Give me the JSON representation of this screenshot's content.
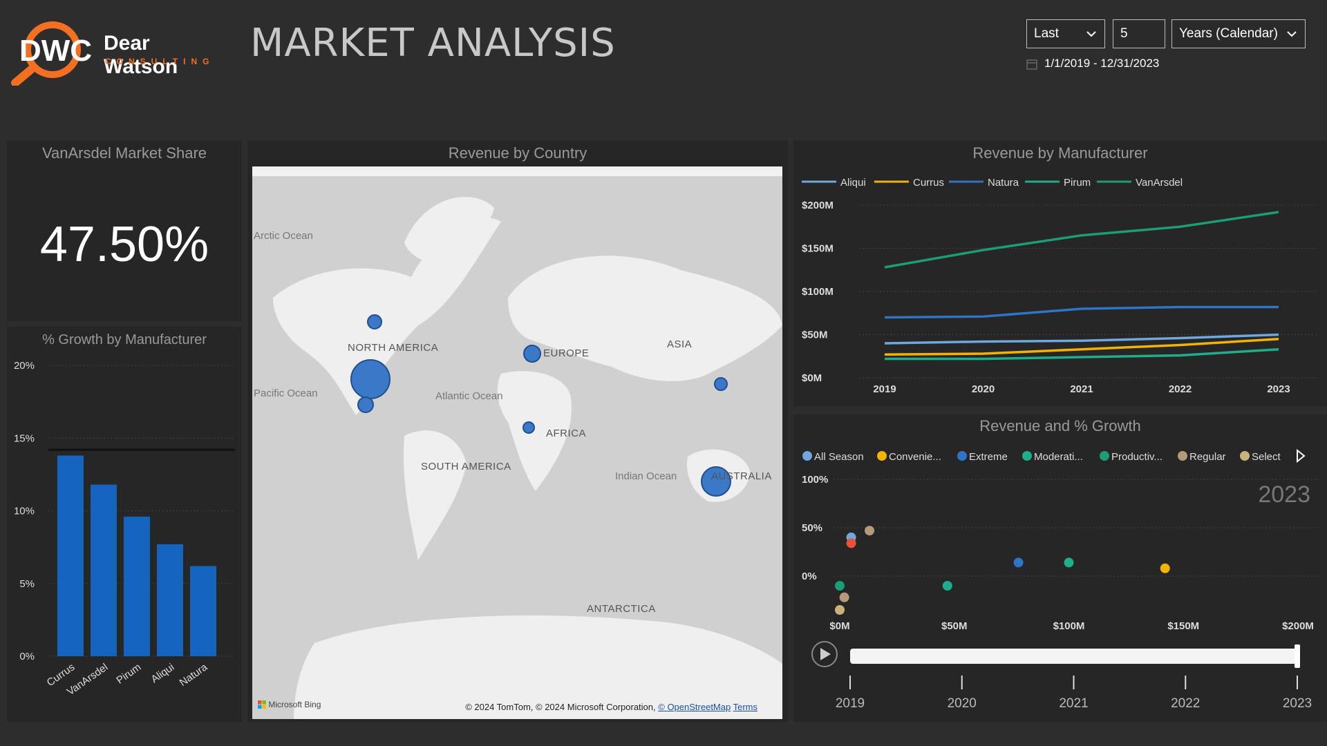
{
  "header": {
    "logo_mark": "DWC",
    "logo_name": "Dear Watson",
    "logo_sub": "CONSULTING",
    "title": "MARKET ANALYSIS"
  },
  "filters": {
    "period": "Last",
    "count": "5",
    "unit": "Years (Calendar)",
    "date_range": "1/1/2019 - 12/31/2023"
  },
  "market_share": {
    "title": "VanArsdel Market Share",
    "value": "47.50%"
  },
  "growth_panel": {
    "title": "% Growth by Manufacturer"
  },
  "map_panel": {
    "title": "Revenue by Country",
    "continents": [
      "NORTH AMERICA",
      "EUROPE",
      "ASIA",
      "AFRICA",
      "SOUTH AMERICA",
      "AUSTRALIA",
      "ANTARCTICA"
    ],
    "oceans": [
      "Arctic Ocean",
      "Pacific Ocean",
      "Atlantic Ocean",
      "Indian Ocean"
    ],
    "bing": "Microsoft Bing",
    "copyright": "© 2024 TomTom, © 2024 Microsoft Corporation,",
    "osm_link": "© OpenStreetMap",
    "terms_link": "Terms"
  },
  "revenue_panel": {
    "title": "Revenue by Manufacturer"
  },
  "scatter_panel": {
    "title": "Revenue and % Growth",
    "year_label": "2023",
    "play_axis_years": [
      "2019",
      "2020",
      "2021",
      "2022",
      "2023"
    ]
  },
  "colors": {
    "bar": "#1565c0",
    "aliqui": "#6fa8dc",
    "curra": "#f2b400",
    "natura": "#2e75c7",
    "pirum": "#1fae8c",
    "vanarsdel": "#1b9e77",
    "accent": "#f36f21"
  },
  "chart_data": [
    {
      "type": "bar",
      "title": "% Growth by Manufacturer",
      "categories": [
        "Currus",
        "VanArsdel",
        "Pirum",
        "Aliqui",
        "Natura"
      ],
      "values": [
        13.8,
        11.8,
        9.6,
        7.7,
        6.2
      ],
      "y_ticks": [
        "0%",
        "5%",
        "10%",
        "15%",
        "20%"
      ],
      "ylim": [
        0,
        20
      ],
      "reference_line": 14.2
    },
    {
      "type": "line",
      "title": "Revenue by Manufacturer",
      "x": [
        "2019",
        "2020",
        "2021",
        "2022",
        "2023"
      ],
      "y_ticks": [
        "$0M",
        "$50M",
        "$100M",
        "$150M",
        "$200M"
      ],
      "ylim": [
        0,
        200
      ],
      "series": [
        {
          "name": "Aliqui",
          "values": [
            40,
            42,
            43,
            46,
            50
          ]
        },
        {
          "name": "Currus",
          "values": [
            27,
            28,
            33,
            38,
            45
          ]
        },
        {
          "name": "Natura",
          "values": [
            70,
            71,
            80,
            82,
            82
          ]
        },
        {
          "name": "Pirum",
          "values": [
            22,
            22,
            24,
            26,
            33
          ]
        },
        {
          "name": "VanArsdel",
          "values": [
            128,
            148,
            165,
            175,
            192
          ]
        }
      ],
      "legend": "top"
    },
    {
      "type": "scatter",
      "title": "Revenue and % Growth",
      "x_ticks": [
        "$0M",
        "$50M",
        "$100M",
        "$150M",
        "$200M"
      ],
      "y_ticks": [
        "0%",
        "50%",
        "100%"
      ],
      "xlim": [
        0,
        200
      ],
      "ylim": [
        -40,
        100
      ],
      "legend": [
        "All Season",
        "Convenie...",
        "Extreme",
        "Moderati...",
        "Productiv...",
        "Regular",
        "Select"
      ],
      "points": [
        {
          "category": "All Season",
          "x": 5,
          "y": 40
        },
        {
          "category": "Convenie...",
          "x": 142,
          "y": 8
        },
        {
          "category": "Extreme",
          "x": 78,
          "y": 14
        },
        {
          "category": "Moderati...",
          "x": 100,
          "y": 14
        },
        {
          "category": "Moderati...",
          "x": 47,
          "y": -10
        },
        {
          "category": "Productiv...",
          "x": 0,
          "y": -10
        },
        {
          "category": "Regular",
          "x": 13,
          "y": 47
        },
        {
          "category": "Regular",
          "x": 2,
          "y": -22
        },
        {
          "category": "Select",
          "x": 0,
          "y": -35
        },
        {
          "category": "Extreme",
          "x": 5,
          "y": 34
        }
      ],
      "year": "2023"
    }
  ]
}
